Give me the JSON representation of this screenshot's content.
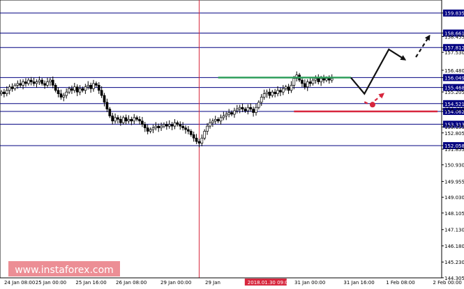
{
  "chart_data": {
    "type": "candlestick",
    "instrument_note": "",
    "ylim": [
      144.3,
      160.6
    ],
    "y_ticks": [
      "159.835",
      "158.661",
      "157.812",
      "156.049",
      "155.468",
      "154.521",
      "154.062",
      "153.313",
      "152.058",
      "158.455",
      "157.530",
      "156.480",
      "155.205",
      "154.205",
      "153.155",
      "152.805",
      "151.855",
      "150.930",
      "149.955",
      "149.030",
      "148.105",
      "147.130",
      "146.180",
      "145.230",
      "144.305"
    ],
    "y_tick_values": [
      159.835,
      158.661,
      157.812,
      156.049,
      155.468,
      154.521,
      154.062,
      153.313,
      152.058,
      158.455,
      157.53,
      156.48,
      155.205,
      154.205,
      153.155,
      152.805,
      151.855,
      150.93,
      149.955,
      149.03,
      148.105,
      147.13,
      146.18,
      145.23,
      144.305
    ],
    "levels": [
      {
        "label": "159.835",
        "value": 159.835,
        "highlight": true
      },
      {
        "label": "158.661",
        "value": 158.661,
        "highlight": true
      },
      {
        "label": "157.812",
        "value": 157.812,
        "highlight": true
      },
      {
        "label": "156.049",
        "value": 156.049,
        "highlight": true
      },
      {
        "label": "155.468",
        "value": 155.468,
        "highlight": true
      },
      {
        "label": "154.521",
        "value": 154.521,
        "highlight": true
      },
      {
        "label": "154.062",
        "value": 154.062,
        "highlight": true
      },
      {
        "label": "153.313",
        "value": 153.313,
        "highlight": true
      },
      {
        "label": "152.058",
        "value": 152.058,
        "highlight": true
      }
    ],
    "x_ticks": [
      "24 Jan 08:00",
      "25 Jan 00:00",
      "25 Jan 16:00",
      "26 Jan 08:00",
      "29 Jan 00:00",
      "29 Jan",
      "2018.01.30 09:00",
      "31 Jan 00:00",
      "31 Jan 16:00",
      "1 Feb 08:00",
      "2 Feb 00:00"
    ],
    "cursor_label": "2018.01.30 09:00",
    "cursor_x_index": 73,
    "close_series": [
      155.2,
      155.1,
      155.3,
      155.5,
      155.4,
      155.6,
      155.7,
      155.6,
      155.8,
      155.7,
      155.9,
      155.8,
      155.7,
      155.8,
      155.9,
      155.7,
      155.6,
      155.8,
      155.9,
      155.6,
      155.3,
      155.1,
      154.9,
      155.0,
      155.2,
      155.4,
      155.3,
      155.5,
      155.2,
      155.4,
      155.3,
      155.5,
      155.6,
      155.4,
      155.7,
      155.6,
      155.3,
      155.0,
      154.6,
      154.2,
      153.8,
      153.5,
      153.7,
      153.6,
      153.4,
      153.7,
      153.5,
      153.6,
      153.5,
      153.7,
      153.6,
      153.5,
      153.3,
      153.1,
      152.9,
      153.0,
      153.1,
      153.2,
      153.1,
      153.2,
      153.3,
      153.2,
      153.3,
      153.2,
      153.4,
      153.3,
      153.2,
      153.1,
      153.0,
      152.9,
      152.7,
      152.5,
      152.3,
      152.2,
      152.5,
      152.9,
      153.2,
      153.4,
      153.5,
      153.6,
      153.5,
      153.7,
      153.8,
      153.9,
      154.0,
      153.9,
      154.1,
      154.2,
      154.3,
      154.2,
      154.1,
      154.3,
      154.2,
      154.0,
      154.3,
      154.6,
      154.9,
      155.1,
      155.2,
      155.0,
      155.2,
      155.1,
      155.3,
      155.2,
      155.4,
      155.5,
      155.3,
      155.6,
      156.0,
      156.2,
      155.9,
      155.7,
      155.5,
      155.8,
      155.7,
      155.9,
      156.0,
      155.8,
      156.0,
      155.9,
      156.0,
      155.9,
      156.0
    ],
    "lines": [
      {
        "name": "green resistance",
        "value": 156.049,
        "x_from_index": 80,
        "x_to_index": 129,
        "color": "#2e9e5b"
      },
      {
        "name": "red support",
        "value": 154.062,
        "x_from_index": 108,
        "x_to_index": 161,
        "color": "#d7263d"
      }
    ],
    "arrows": [
      {
        "name": "black path",
        "color": "#111111",
        "style": "solid",
        "points": [
          [
            129,
            156.049
          ],
          [
            134,
            155.1
          ],
          [
            143,
            157.7
          ],
          [
            149,
            157.1
          ]
        ]
      },
      {
        "name": "black continuation",
        "color": "#111111",
        "style": "dashed",
        "points": [
          [
            153,
            157.25
          ],
          [
            158,
            158.5
          ]
        ]
      },
      {
        "name": "red path",
        "color": "#d7263d",
        "style": "dashed",
        "points": [
          [
            134,
            154.62
          ],
          [
            136,
            154.46
          ],
          [
            141,
            155.1
          ]
        ]
      }
    ],
    "colors": {
      "axis": "#000000",
      "grid": "#000080",
      "cursor": "#d7263d",
      "candle_up": "#ffffff",
      "candle_down": "#000000",
      "tag_fill": "#000080",
      "tag_text": "#ffffff",
      "watermark_bg": "#e97a82"
    },
    "watermark": "www.instaforex.com"
  }
}
